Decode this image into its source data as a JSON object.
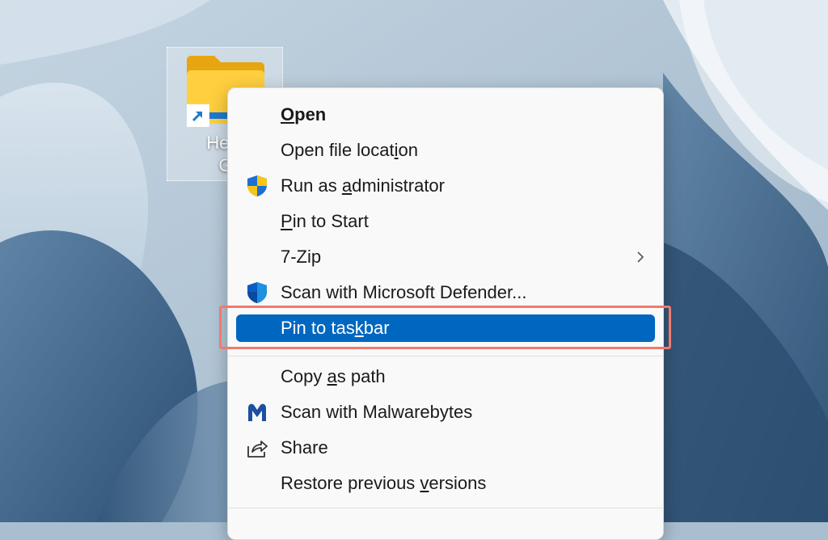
{
  "desktop": {
    "shortcut": {
      "label_line1": "Help",
      "label_line2": "Ge",
      "icon": "folder-icon",
      "overlay_icon": "shortcut-arrow-icon"
    }
  },
  "context_menu": {
    "items": [
      {
        "label": "Open",
        "underline": "O",
        "icon": null,
        "bold": true
      },
      {
        "label": "Open file location",
        "underline": "i",
        "icon": null
      },
      {
        "label": "Run as administrator",
        "underline": "a",
        "icon": "uac-shield-icon"
      },
      {
        "label": "Pin to Start",
        "underline": "P",
        "icon": null
      },
      {
        "label": "7-Zip",
        "underline": "",
        "icon": null,
        "submenu_icon": "chevron-right-icon"
      },
      {
        "label": "Scan with Microsoft Defender...",
        "underline": "",
        "icon": "defender-shield-icon"
      },
      {
        "label": "Pin to taskbar",
        "underline": "k",
        "icon": null,
        "selected": true
      },
      {
        "label": "Copy as path",
        "underline": "a",
        "icon": null
      },
      {
        "label": "Scan with Malwarebytes",
        "underline": "",
        "icon": "malwarebytes-icon"
      },
      {
        "label": "Share",
        "underline": "",
        "icon": "share-icon"
      },
      {
        "label": "Restore previous versions",
        "underline": "v",
        "icon": null
      }
    ]
  },
  "colors": {
    "selection": "#0067c0",
    "annotation_highlight": "#f07a6e",
    "menu_background": "#f9f9f9"
  }
}
